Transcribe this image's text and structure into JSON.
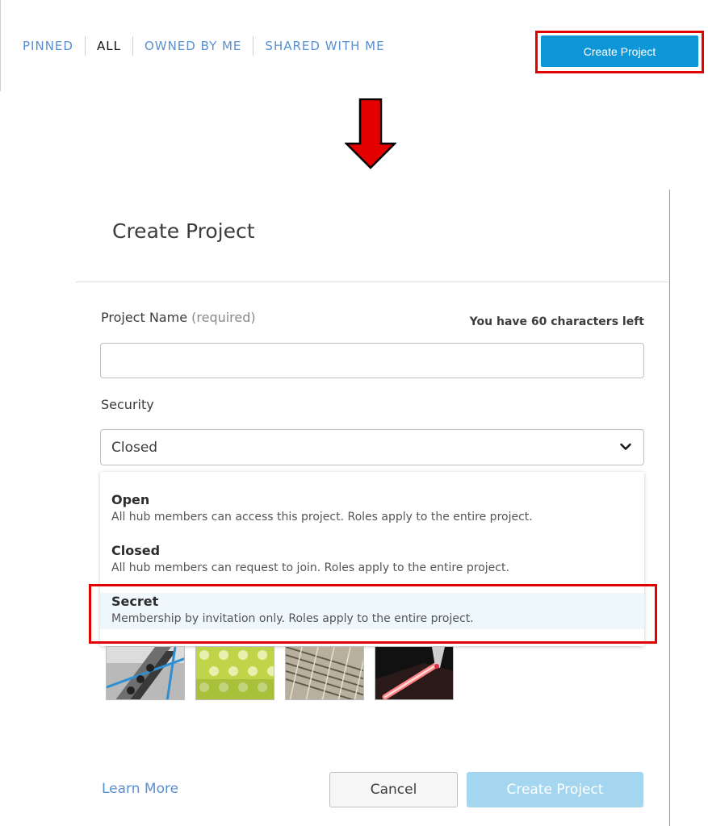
{
  "tabs": [
    {
      "label": "PINNED",
      "active": false
    },
    {
      "label": "ALL",
      "active": true
    },
    {
      "label": "OWNED BY ME",
      "active": false
    },
    {
      "label": "SHARED WITH ME",
      "active": false
    }
  ],
  "top_button": {
    "label": "Create Project"
  },
  "colors": {
    "accent": "#0d96d8",
    "link": "#5a8fd0",
    "highlight": "#e50000",
    "arrow": "#e50000",
    "disabled_button": "#a4d6ef",
    "selected_option_bg": "#eef7fb"
  },
  "dialog": {
    "title": "Create Project",
    "project_name": {
      "label": "Project Name",
      "required_hint": "(required)",
      "chars_left": "You have 60 characters left",
      "value": "",
      "placeholder": ""
    },
    "security": {
      "label": "Security",
      "selected": "Closed",
      "options": [
        {
          "title": "Open",
          "description": "All hub members can access this project. Roles apply to the entire project."
        },
        {
          "title": "Closed",
          "description": "All hub members can request to join. Roles apply to the entire project."
        },
        {
          "title": "Secret",
          "description": "Membership by invitation only. Roles apply to the entire project.",
          "hovered": true
        }
      ]
    },
    "footer": {
      "learn_more": "Learn More",
      "cancel": "Cancel",
      "create": "Create Project"
    }
  },
  "icons": [
    "arrow-down-icon",
    "chevron-down-icon"
  ]
}
